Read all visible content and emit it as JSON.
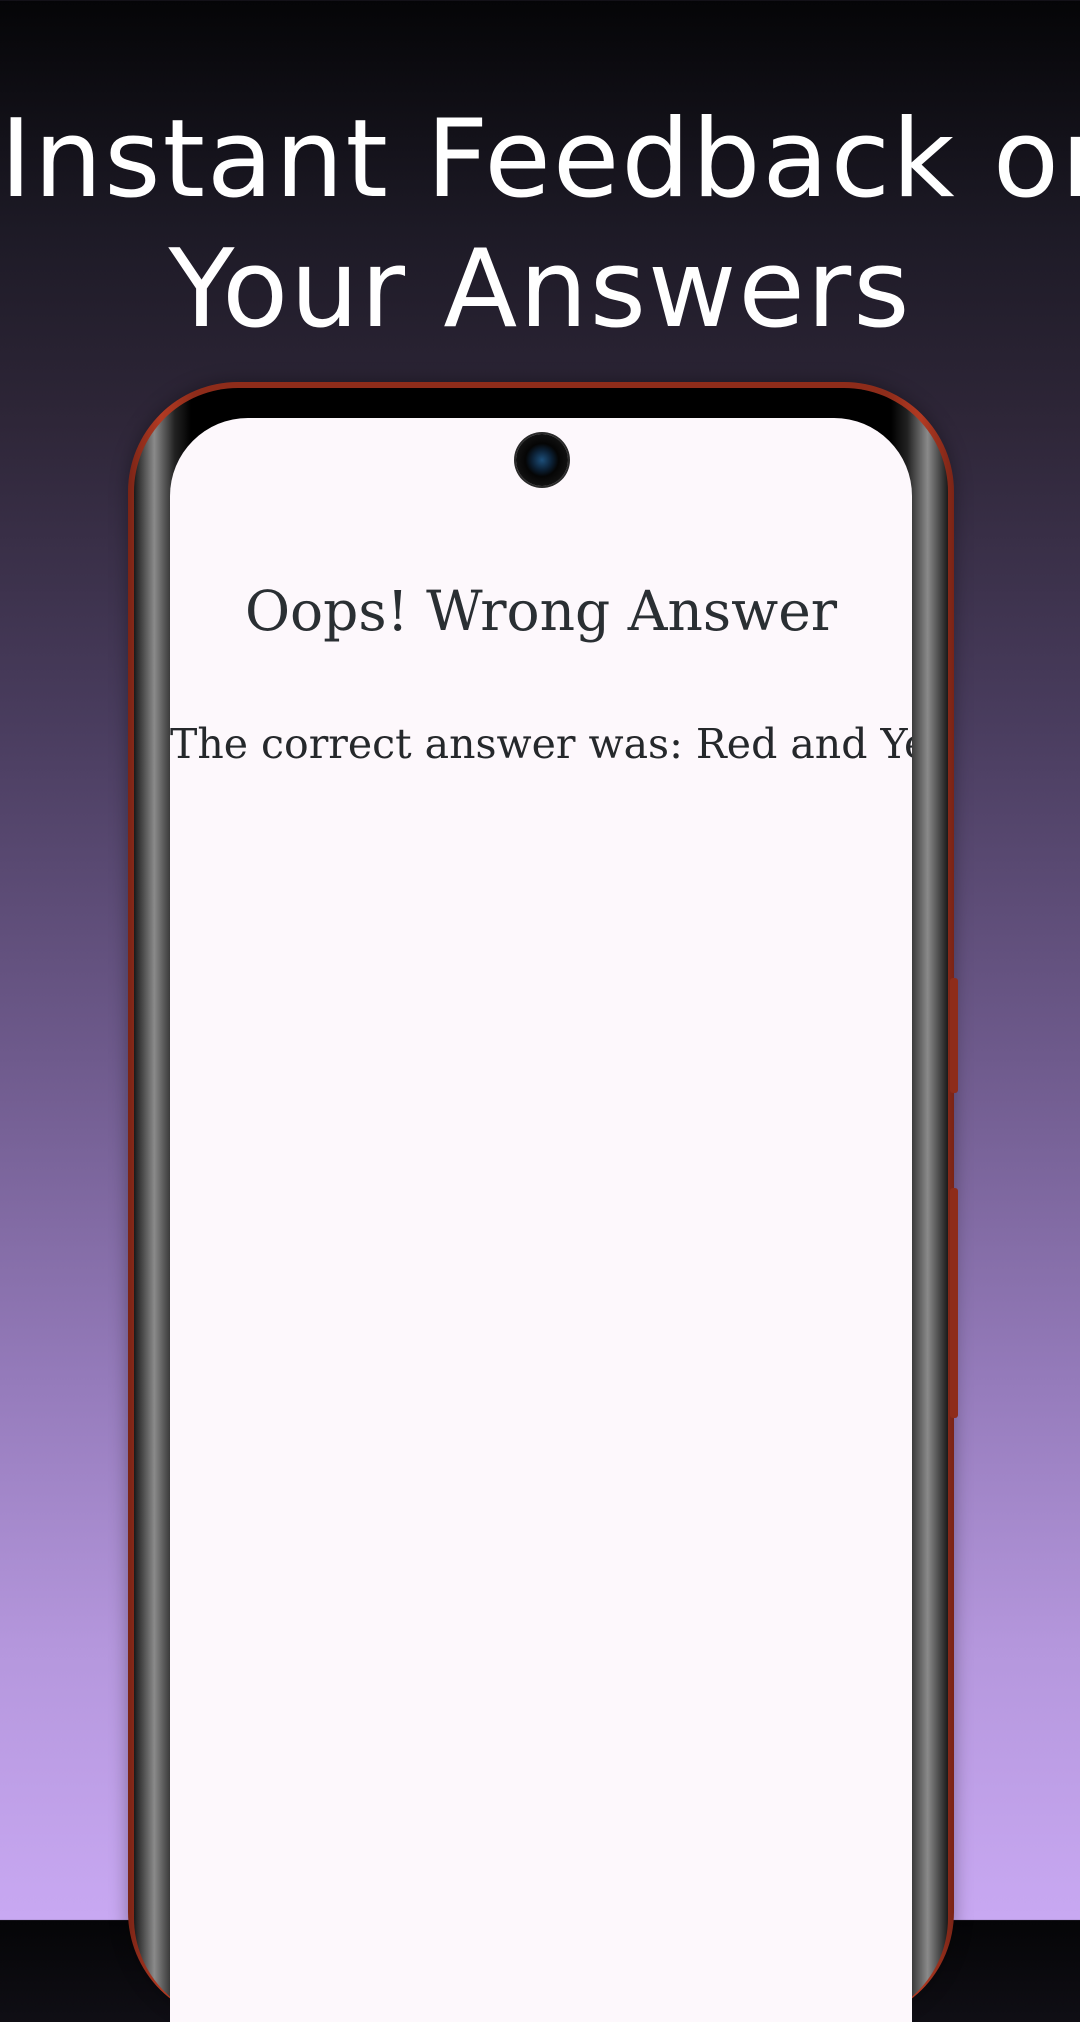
{
  "headline": {
    "line1": "Instant Feedback on",
    "line2": "Your Answers"
  },
  "screen": {
    "title": "Oops! Wrong Answer",
    "message": "The correct answer was: Red and Yellow"
  },
  "colors": {
    "frame_accent": "#8e2c1a",
    "screen_background": "#fdf8fc",
    "text": "#2a2f33"
  }
}
